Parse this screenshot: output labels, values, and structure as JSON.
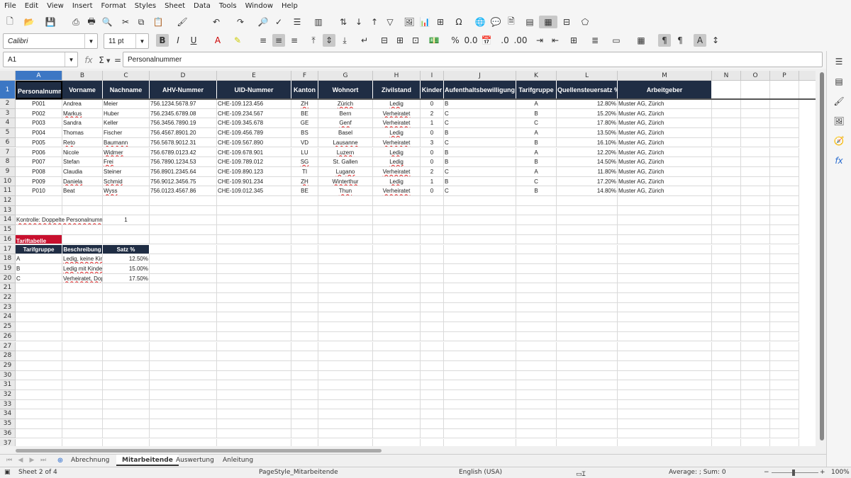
{
  "menu": [
    "File",
    "Edit",
    "View",
    "Insert",
    "Format",
    "Styles",
    "Sheet",
    "Data",
    "Tools",
    "Window",
    "Help"
  ],
  "font_name": "Calibri",
  "font_size": "11 pt",
  "name_box": "A1",
  "formula": "Personalnummer",
  "columns": [
    "A",
    "B",
    "C",
    "D",
    "E",
    "F",
    "G",
    "H",
    "I",
    "J",
    "K",
    "L",
    "M",
    "N",
    "O",
    "P"
  ],
  "headers": [
    "Personalnummer",
    "Vorname",
    "Nachname",
    "AHV-Nummer",
    "UID-Nummer",
    "Kanton",
    "Wohnort",
    "Zivilstand",
    "Kinder",
    "Aufenthaltsbewilligung",
    "Tarifgruppe",
    "Quellensteuersatz %",
    "Arbeitgeber"
  ],
  "rows": [
    [
      "P001",
      "Andrea",
      "Meier",
      "756.1234.5678.97",
      "CHE-109.123.456",
      "ZH",
      "Zürich",
      "Ledig",
      "0",
      "B",
      "A",
      "12.80%",
      "Muster AG, Zürich"
    ],
    [
      "P002",
      "Markus",
      "Huber",
      "756.2345.6789.08",
      "CHE-109.234.567",
      "BE",
      "Bern",
      "Verheiratet",
      "2",
      "C",
      "B",
      "15.20%",
      "Muster AG, Zürich"
    ],
    [
      "P003",
      "Sandra",
      "Keller",
      "756.3456.7890.19",
      "CHE-109.345.678",
      "GE",
      "Genf",
      "Verheiratet",
      "1",
      "C",
      "C",
      "17.80%",
      "Muster AG, Zürich"
    ],
    [
      "P004",
      "Thomas",
      "Fischer",
      "756.4567.8901.20",
      "CHE-109.456.789",
      "BS",
      "Basel",
      "Ledig",
      "0",
      "B",
      "A",
      "13.50%",
      "Muster AG, Zürich"
    ],
    [
      "P005",
      "Reto",
      "Baumann",
      "756.5678.9012.31",
      "CHE-109.567.890",
      "VD",
      "Lausanne",
      "Verheiratet",
      "3",
      "C",
      "B",
      "16.10%",
      "Muster AG, Zürich"
    ],
    [
      "P006",
      "Nicole",
      "Widmer",
      "756.6789.0123.42",
      "CHE-109.678.901",
      "LU",
      "Luzern",
      "Ledig",
      "0",
      "B",
      "A",
      "12.20%",
      "Muster AG, Zürich"
    ],
    [
      "P007",
      "Stefan",
      "Frei",
      "756.7890.1234.53",
      "CHE-109.789.012",
      "SG",
      "St. Gallen",
      "Ledig",
      "0",
      "B",
      "B",
      "14.50%",
      "Muster AG, Zürich"
    ],
    [
      "P008",
      "Claudia",
      "Steiner",
      "756.8901.2345.64",
      "CHE-109.890.123",
      "TI",
      "Lugano",
      "Verheiratet",
      "2",
      "C",
      "A",
      "11.80%",
      "Muster AG, Zürich"
    ],
    [
      "P009",
      "Daniela",
      "Schmid",
      "756.9012.3456.75",
      "CHE-109.901.234",
      "ZH",
      "Winterthur",
      "Ledig",
      "1",
      "B",
      "C",
      "17.20%",
      "Muster AG, Zürich"
    ],
    [
      "P010",
      "Beat",
      "Wyss",
      "756.0123.4567.86",
      "CHE-109.012.345",
      "BE",
      "Thun",
      "Verheiratet",
      "0",
      "C",
      "B",
      "14.80%",
      "Muster AG, Zürich"
    ]
  ],
  "check_label": "Kontrolle: Doppelte Personalnummern",
  "check_value": "1",
  "tarif_title": "Tariftabelle",
  "tarif_headers": [
    "Tarifgruppe",
    "Beschreibung",
    "Satz %"
  ],
  "tarif_rows": [
    [
      "A",
      "Ledig, keine Kinder",
      "12.50%"
    ],
    [
      "B",
      "Ledig mit Kindern",
      "15.00%"
    ],
    [
      "C",
      "Verheiratet, Doppelverdiener",
      "17.50%"
    ]
  ],
  "tabs": [
    "Abrechnung",
    "Mitarbeitende",
    "Auswertung",
    "Anleitung"
  ],
  "status": {
    "sheet": "Sheet 2 of 4",
    "pagestyle": "PageStyle_Mitarbeitende",
    "lang": "English (USA)",
    "sum": "Average: ; Sum: 0",
    "zoom": "100%"
  }
}
